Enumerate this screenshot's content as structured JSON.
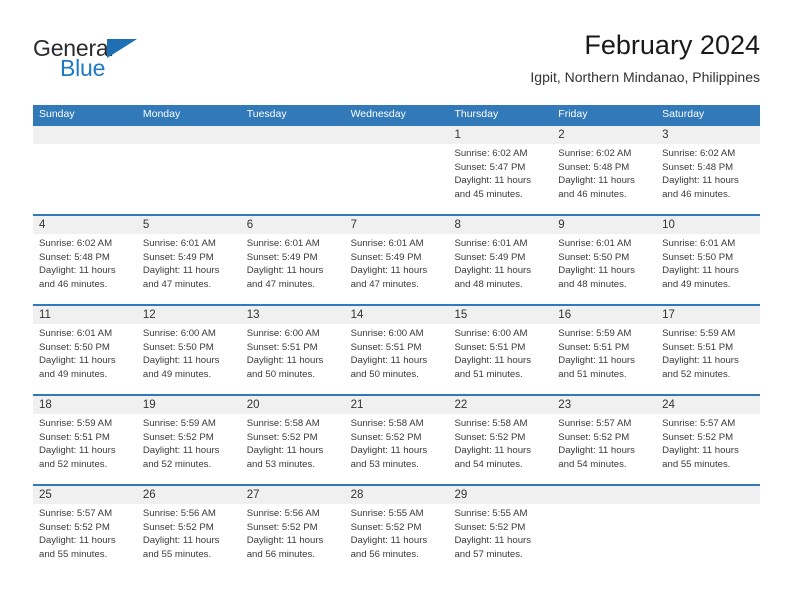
{
  "brand": {
    "name_top": "General",
    "name_bottom": "Blue",
    "top_color": "#2b2b2b",
    "bottom_color": "#1f7ac4",
    "triangle_color": "#1f6fb5"
  },
  "header": {
    "title": "February 2024",
    "subtitle": "Igpit, Northern Mindanao, Philippines"
  },
  "theme": {
    "header_blue": "#3179b9",
    "daynum_band": "#f0f0f0",
    "text": "#3a3a3a"
  },
  "weekday_headers": [
    "Sunday",
    "Monday",
    "Tuesday",
    "Wednesday",
    "Thursday",
    "Friday",
    "Saturday"
  ],
  "weeks": [
    [
      {
        "day": "",
        "sunrise": "",
        "sunset": "",
        "daylight": "",
        "daylight2": ""
      },
      {
        "day": "",
        "sunrise": "",
        "sunset": "",
        "daylight": "",
        "daylight2": ""
      },
      {
        "day": "",
        "sunrise": "",
        "sunset": "",
        "daylight": "",
        "daylight2": ""
      },
      {
        "day": "",
        "sunrise": "",
        "sunset": "",
        "daylight": "",
        "daylight2": ""
      },
      {
        "day": "1",
        "sunrise": "Sunrise: 6:02 AM",
        "sunset": "Sunset: 5:47 PM",
        "daylight": "Daylight: 11 hours",
        "daylight2": "and 45 minutes."
      },
      {
        "day": "2",
        "sunrise": "Sunrise: 6:02 AM",
        "sunset": "Sunset: 5:48 PM",
        "daylight": "Daylight: 11 hours",
        "daylight2": "and 46 minutes."
      },
      {
        "day": "3",
        "sunrise": "Sunrise: 6:02 AM",
        "sunset": "Sunset: 5:48 PM",
        "daylight": "Daylight: 11 hours",
        "daylight2": "and 46 minutes."
      }
    ],
    [
      {
        "day": "4",
        "sunrise": "Sunrise: 6:02 AM",
        "sunset": "Sunset: 5:48 PM",
        "daylight": "Daylight: 11 hours",
        "daylight2": "and 46 minutes."
      },
      {
        "day": "5",
        "sunrise": "Sunrise: 6:01 AM",
        "sunset": "Sunset: 5:49 PM",
        "daylight": "Daylight: 11 hours",
        "daylight2": "and 47 minutes."
      },
      {
        "day": "6",
        "sunrise": "Sunrise: 6:01 AM",
        "sunset": "Sunset: 5:49 PM",
        "daylight": "Daylight: 11 hours",
        "daylight2": "and 47 minutes."
      },
      {
        "day": "7",
        "sunrise": "Sunrise: 6:01 AM",
        "sunset": "Sunset: 5:49 PM",
        "daylight": "Daylight: 11 hours",
        "daylight2": "and 47 minutes."
      },
      {
        "day": "8",
        "sunrise": "Sunrise: 6:01 AM",
        "sunset": "Sunset: 5:49 PM",
        "daylight": "Daylight: 11 hours",
        "daylight2": "and 48 minutes."
      },
      {
        "day": "9",
        "sunrise": "Sunrise: 6:01 AM",
        "sunset": "Sunset: 5:50 PM",
        "daylight": "Daylight: 11 hours",
        "daylight2": "and 48 minutes."
      },
      {
        "day": "10",
        "sunrise": "Sunrise: 6:01 AM",
        "sunset": "Sunset: 5:50 PM",
        "daylight": "Daylight: 11 hours",
        "daylight2": "and 49 minutes."
      }
    ],
    [
      {
        "day": "11",
        "sunrise": "Sunrise: 6:01 AM",
        "sunset": "Sunset: 5:50 PM",
        "daylight": "Daylight: 11 hours",
        "daylight2": "and 49 minutes."
      },
      {
        "day": "12",
        "sunrise": "Sunrise: 6:00 AM",
        "sunset": "Sunset: 5:50 PM",
        "daylight": "Daylight: 11 hours",
        "daylight2": "and 49 minutes."
      },
      {
        "day": "13",
        "sunrise": "Sunrise: 6:00 AM",
        "sunset": "Sunset: 5:51 PM",
        "daylight": "Daylight: 11 hours",
        "daylight2": "and 50 minutes."
      },
      {
        "day": "14",
        "sunrise": "Sunrise: 6:00 AM",
        "sunset": "Sunset: 5:51 PM",
        "daylight": "Daylight: 11 hours",
        "daylight2": "and 50 minutes."
      },
      {
        "day": "15",
        "sunrise": "Sunrise: 6:00 AM",
        "sunset": "Sunset: 5:51 PM",
        "daylight": "Daylight: 11 hours",
        "daylight2": "and 51 minutes."
      },
      {
        "day": "16",
        "sunrise": "Sunrise: 5:59 AM",
        "sunset": "Sunset: 5:51 PM",
        "daylight": "Daylight: 11 hours",
        "daylight2": "and 51 minutes."
      },
      {
        "day": "17",
        "sunrise": "Sunrise: 5:59 AM",
        "sunset": "Sunset: 5:51 PM",
        "daylight": "Daylight: 11 hours",
        "daylight2": "and 52 minutes."
      }
    ],
    [
      {
        "day": "18",
        "sunrise": "Sunrise: 5:59 AM",
        "sunset": "Sunset: 5:51 PM",
        "daylight": "Daylight: 11 hours",
        "daylight2": "and 52 minutes."
      },
      {
        "day": "19",
        "sunrise": "Sunrise: 5:59 AM",
        "sunset": "Sunset: 5:52 PM",
        "daylight": "Daylight: 11 hours",
        "daylight2": "and 52 minutes."
      },
      {
        "day": "20",
        "sunrise": "Sunrise: 5:58 AM",
        "sunset": "Sunset: 5:52 PM",
        "daylight": "Daylight: 11 hours",
        "daylight2": "and 53 minutes."
      },
      {
        "day": "21",
        "sunrise": "Sunrise: 5:58 AM",
        "sunset": "Sunset: 5:52 PM",
        "daylight": "Daylight: 11 hours",
        "daylight2": "and 53 minutes."
      },
      {
        "day": "22",
        "sunrise": "Sunrise: 5:58 AM",
        "sunset": "Sunset: 5:52 PM",
        "daylight": "Daylight: 11 hours",
        "daylight2": "and 54 minutes."
      },
      {
        "day": "23",
        "sunrise": "Sunrise: 5:57 AM",
        "sunset": "Sunset: 5:52 PM",
        "daylight": "Daylight: 11 hours",
        "daylight2": "and 54 minutes."
      },
      {
        "day": "24",
        "sunrise": "Sunrise: 5:57 AM",
        "sunset": "Sunset: 5:52 PM",
        "daylight": "Daylight: 11 hours",
        "daylight2": "and 55 minutes."
      }
    ],
    [
      {
        "day": "25",
        "sunrise": "Sunrise: 5:57 AM",
        "sunset": "Sunset: 5:52 PM",
        "daylight": "Daylight: 11 hours",
        "daylight2": "and 55 minutes."
      },
      {
        "day": "26",
        "sunrise": "Sunrise: 5:56 AM",
        "sunset": "Sunset: 5:52 PM",
        "daylight": "Daylight: 11 hours",
        "daylight2": "and 55 minutes."
      },
      {
        "day": "27",
        "sunrise": "Sunrise: 5:56 AM",
        "sunset": "Sunset: 5:52 PM",
        "daylight": "Daylight: 11 hours",
        "daylight2": "and 56 minutes."
      },
      {
        "day": "28",
        "sunrise": "Sunrise: 5:55 AM",
        "sunset": "Sunset: 5:52 PM",
        "daylight": "Daylight: 11 hours",
        "daylight2": "and 56 minutes."
      },
      {
        "day": "29",
        "sunrise": "Sunrise: 5:55 AM",
        "sunset": "Sunset: 5:52 PM",
        "daylight": "Daylight: 11 hours",
        "daylight2": "and 57 minutes."
      },
      {
        "day": "",
        "sunrise": "",
        "sunset": "",
        "daylight": "",
        "daylight2": ""
      },
      {
        "day": "",
        "sunrise": "",
        "sunset": "",
        "daylight": "",
        "daylight2": ""
      }
    ]
  ]
}
